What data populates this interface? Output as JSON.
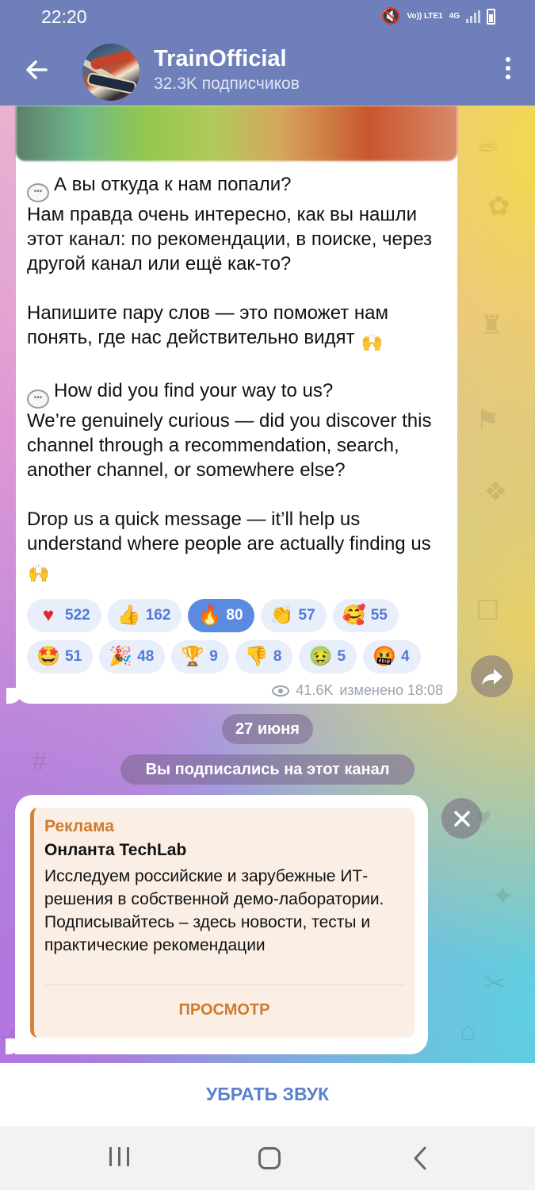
{
  "status_bar": {
    "time": "22:20",
    "network_vo": "Vo)) LTE1",
    "network_type": "4G"
  },
  "header": {
    "channel_name": "TrainOfficial",
    "subscribers": "32.3K подписчиков",
    "icons": [
      "back-arrow-icon",
      "channel-avatar",
      "more-vert-icon"
    ]
  },
  "post": {
    "paragraphs": [
      {
        "icon": "speech-bubble-icon",
        "text": "А вы откуда к нам попали?\nНам правда очень интересно, как вы нашли этот канал: по рекомендации, в поиске, через другой канал или ещё как-то?"
      },
      {
        "text": "Напишите пару слов — это поможет нам понять, где нас действительно видят",
        "end_icon": "raising-hands-icon"
      },
      {
        "icon": "speech-bubble-icon",
        "text": "How did you find your way to us?\nWe’re genuinely curious — did you discover this channel through a recommendation, search, another channel, or somewhere else?"
      },
      {
        "text": "Drop us a quick message — it’ll help us understand where people are actually finding us",
        "end_icon": "raising-hands-icon"
      }
    ],
    "reactions": [
      {
        "icon": "red-heart-icon",
        "count": "522",
        "active": false
      },
      {
        "icon": "thumbs-up-icon",
        "count": "162",
        "active": false
      },
      {
        "icon": "fire-icon",
        "count": "80",
        "active": true
      },
      {
        "icon": "clapping-hands-icon",
        "count": "57",
        "active": false
      },
      {
        "icon": "smiling-face-hearts-icon",
        "count": "55",
        "active": false
      },
      {
        "icon": "star-struck-icon",
        "count": "51",
        "active": false
      },
      {
        "icon": "party-popper-icon",
        "count": "48",
        "active": false
      },
      {
        "icon": "trophy-icon",
        "count": "9",
        "active": false
      },
      {
        "icon": "thumbs-down-icon",
        "count": "8",
        "active": false
      },
      {
        "icon": "nauseated-face-icon",
        "count": "5",
        "active": false
      },
      {
        "icon": "cursing-face-icon",
        "count": "4",
        "active": false
      }
    ],
    "views": "41.6K",
    "edited": "изменено 18:08"
  },
  "service": {
    "date": "27 июня",
    "subscribed": "Вы подписались на этот канал"
  },
  "sponsored": {
    "label": "Реклама",
    "title": "Онланта TechLab",
    "body": "Исследуем российские и зарубежные ИТ-решения в собственной демо-лаборатории. Подписывайтесь – здесь новости, тесты и практические рекомендации",
    "button": "ПРОСМОТР"
  },
  "bottom_bar": {
    "mute_label": "УБРАТЬ ЗВУК"
  },
  "colors": {
    "header_bg": "#6f7fb9",
    "accent": "#5b80cf",
    "reaction_bg": "#e9eefb",
    "reaction_active": "#5b8be0",
    "ad_accent": "#d07a2e"
  }
}
